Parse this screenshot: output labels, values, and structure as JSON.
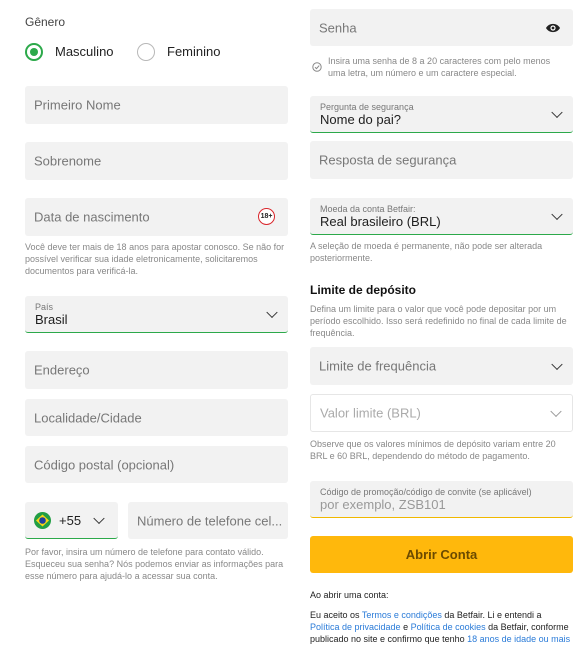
{
  "gender": {
    "heading": "Gênero",
    "option_male": "Masculino",
    "option_female": "Feminino",
    "selected": "Masculino"
  },
  "first_name": {
    "placeholder": "Primeiro Nome"
  },
  "last_name": {
    "placeholder": "Sobrenome"
  },
  "birth_date": {
    "placeholder": "Data de nascimento",
    "badge": "18+",
    "help": "Você deve ter mais de 18 anos para apostar conosco. Se não for possível verificar sua idade eletronicamente, solicitaremos documentos para verificá-la."
  },
  "country": {
    "label": "País",
    "value": "Brasil"
  },
  "address": {
    "placeholder": "Endereço"
  },
  "city": {
    "placeholder": "Localidade/Cidade"
  },
  "postal": {
    "placeholder": "Código postal (opcional)"
  },
  "phone": {
    "code": "+55",
    "placeholder": "Número de telefone cel...",
    "help": "Por favor, insira um número de telefone para contato válido. Esqueceu sua senha? Nós podemos enviar as informações para esse número para ajudá-lo a acessar sua conta."
  },
  "password": {
    "placeholder": "Senha",
    "help": "Insira uma senha de 8 a 20 caracteres com pelo menos uma letra, um número e um caractere especial."
  },
  "security_question": {
    "label": "Pergunta de segurança",
    "value": "Nome do pai?"
  },
  "security_answer": {
    "placeholder": "Resposta de segurança"
  },
  "currency": {
    "label": "Moeda da conta Betfair:",
    "value": "Real brasileiro (BRL)",
    "help": "A seleção de moeda é permanente, não pode ser alterada posteriormente."
  },
  "deposit": {
    "heading": "Limite de depósito",
    "description": "Defina um limite para o valor que você pode depositar por um período escolhido. Isso será redefinido no final de cada limite de frequência.",
    "frequency_placeholder": "Limite de frequência",
    "amount_placeholder": "Valor limite (BRL)",
    "note": "Observe que os valores mínimos de depósito variam entre 20 BRL e 60 BRL, dependendo do método de pagamento."
  },
  "promo": {
    "label": "Código de promoção/código de convite (se aplicável)",
    "placeholder": "por exemplo, ZSB101"
  },
  "submit_label": "Abrir Conta",
  "terms": {
    "intro": "Ao abrir uma conta:",
    "t1": "Eu aceito os ",
    "link_terms": "Termos e condições",
    "t2": " da Betfair. Li e entendi a ",
    "link_privacy": "Política de privacidade",
    "t3": " e ",
    "link_cookies": "Política de cookies",
    "t4": " da Betfair, conforme publicado no site e confirmo que tenho ",
    "link_age": "18 anos de idade ou mais"
  },
  "colors": {
    "accent_green": "#2ca94a",
    "button_yellow": "#ffb80c",
    "link_blue": "#2a7bd8",
    "field_bg": "#f2f2f2"
  }
}
